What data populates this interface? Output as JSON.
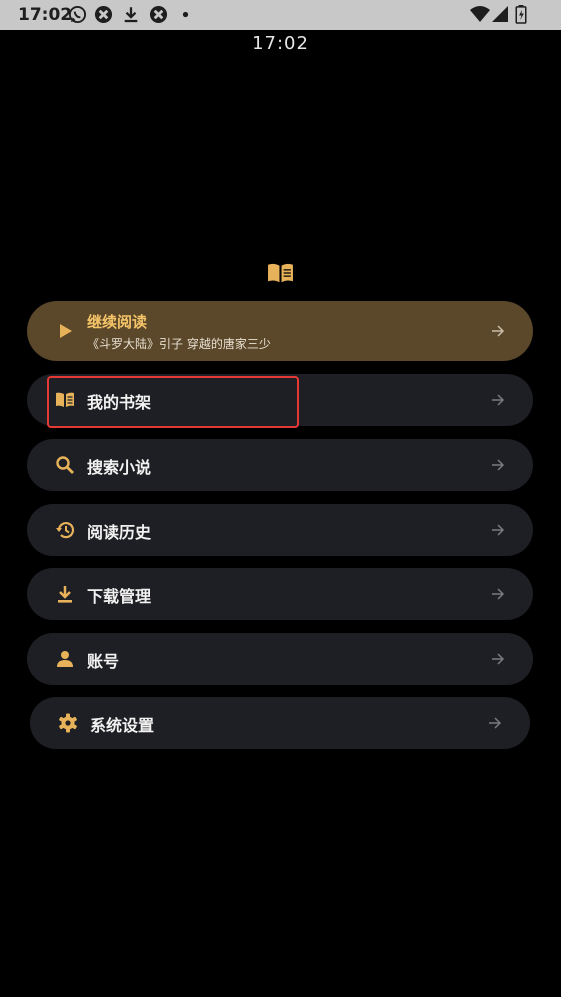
{
  "status_bar": {
    "time": "17:02",
    "left_icons": [
      "whatsapp-icon",
      "app-icon",
      "download-icon",
      "app-icon",
      "dot-icon"
    ],
    "right_icons": [
      "wifi-icon",
      "signal-icon",
      "battery-charging-icon"
    ]
  },
  "clock": "17:02",
  "logo_icon": "book-open-icon",
  "menu": {
    "continue": {
      "title": "继续阅读",
      "subtitle": "《斗罗大陆》引子 穿越的唐家三少",
      "icon": "play-icon"
    },
    "items": [
      {
        "label": "我的书架",
        "icon": "book-icon"
      },
      {
        "label": "搜索小说",
        "icon": "search-icon"
      },
      {
        "label": "阅读历史",
        "icon": "history-icon"
      },
      {
        "label": "下载管理",
        "icon": "download-icon"
      },
      {
        "label": "账号",
        "icon": "person-icon"
      },
      {
        "label": "系统设置",
        "icon": "gear-icon"
      }
    ]
  },
  "colors": {
    "background": "#000000",
    "card": "#1e1f24",
    "continue_card": "#5b4729",
    "accent": "#e8b25a",
    "highlight": "#e53935"
  }
}
